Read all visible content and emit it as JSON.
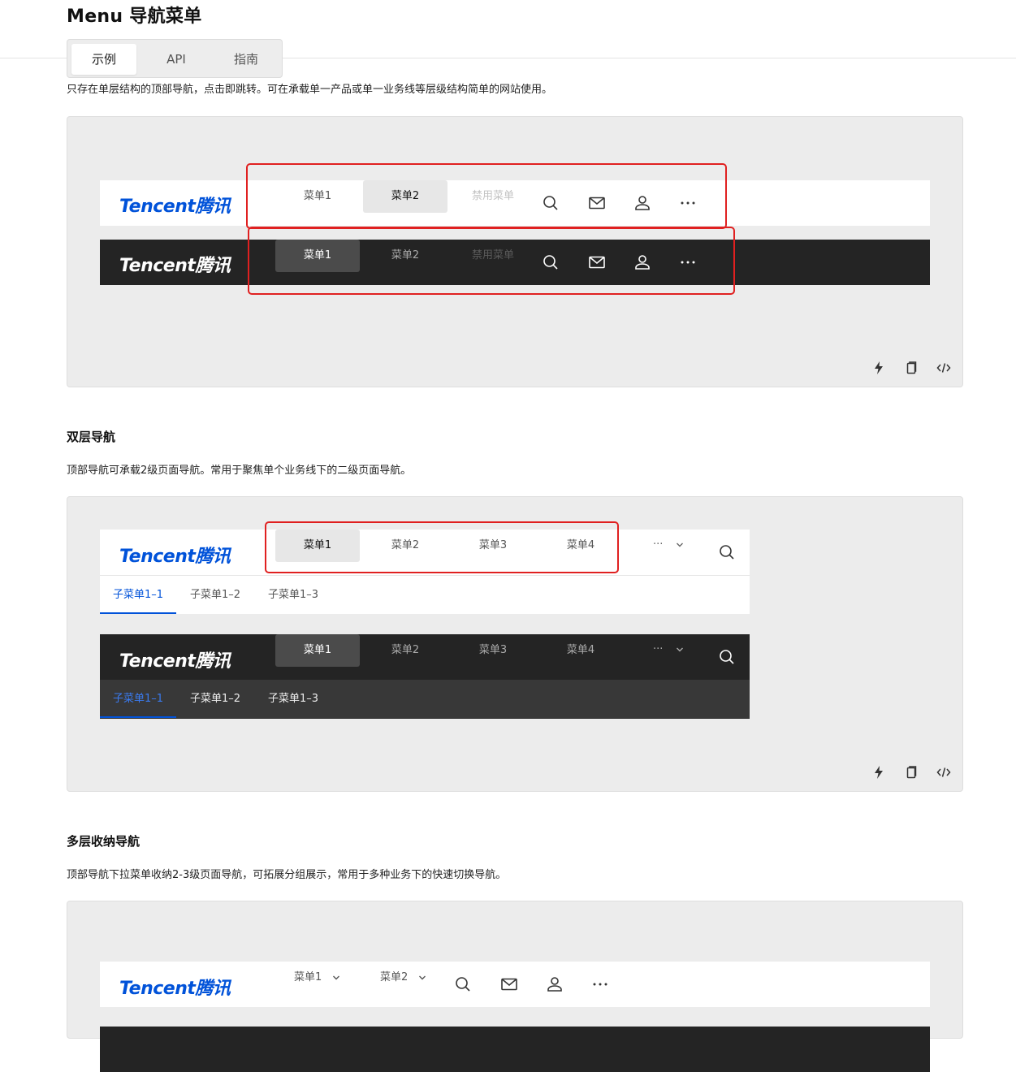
{
  "page": {
    "title": "Menu 导航菜单"
  },
  "tabs": [
    {
      "label": "示例"
    },
    {
      "label": "API"
    },
    {
      "label": "指南"
    }
  ],
  "section1": {
    "desc": "只存在单层结构的顶部导航，点击即跳转。可在承载单一产品或单一业务线等层级结构简单的网站使用。",
    "light": {
      "logo": "Tencent腾讯",
      "items": [
        {
          "label": "菜单1"
        },
        {
          "label": "菜单2"
        },
        {
          "label": "禁用菜单"
        }
      ]
    },
    "dark": {
      "logo": "Tencent腾讯",
      "items": [
        {
          "label": "菜单1"
        },
        {
          "label": "菜单2"
        },
        {
          "label": "禁用菜单"
        }
      ]
    },
    "icons": [
      "search-icon",
      "mail-icon",
      "user-icon",
      "more-icon"
    ]
  },
  "section2": {
    "title": "双层导航",
    "desc": "顶部导航可承载2级页面导航。常用于聚焦单个业务线下的二级页面导航。",
    "light": {
      "logo": "Tencent腾讯",
      "items": [
        {
          "label": "菜单1"
        },
        {
          "label": "菜单2"
        },
        {
          "label": "菜单3"
        },
        {
          "label": "菜单4"
        }
      ],
      "more": "···",
      "sub_items": [
        {
          "label": "子菜单1–1"
        },
        {
          "label": "子菜单1–2"
        },
        {
          "label": "子菜单1–3"
        }
      ]
    },
    "dark": {
      "logo": "Tencent腾讯",
      "items": [
        {
          "label": "菜单1"
        },
        {
          "label": "菜单2"
        },
        {
          "label": "菜单3"
        },
        {
          "label": "菜单4"
        }
      ],
      "more": "···",
      "sub_items": [
        {
          "label": "子菜单1–1"
        },
        {
          "label": "子菜单1–2"
        },
        {
          "label": "子菜单1–3"
        }
      ]
    }
  },
  "section3": {
    "title": "多层收纳导航",
    "desc": "顶部导航下拉菜单收纳2-3级页面导航，可拓展分组展示，常用于多种业务下的快速切换导航。",
    "light": {
      "logo": "Tencent腾讯",
      "items": [
        {
          "label": "菜单1"
        },
        {
          "label": "菜单2"
        }
      ]
    }
  },
  "colors": {
    "accent": "#0052d9",
    "dark_bar": "#242424",
    "dark_sub": "#383838",
    "highlight_box": "#e02020"
  }
}
